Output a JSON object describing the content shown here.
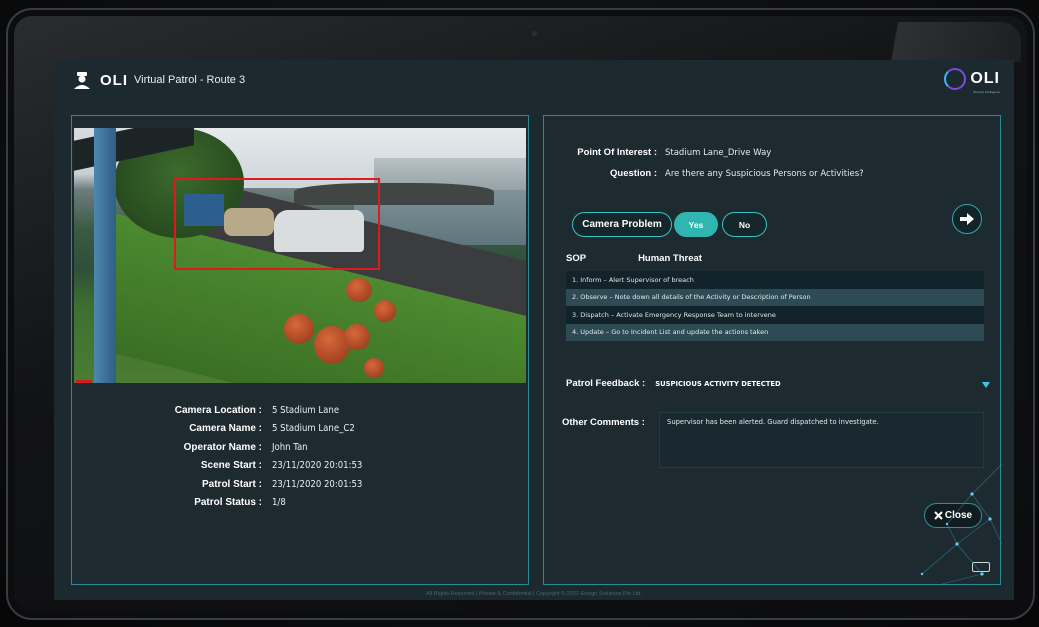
{
  "header": {
    "brand": "OLI",
    "title": "Virtual Patrol - Route 3",
    "logo_text": "OLI",
    "logo_sub": "Security Intelligence"
  },
  "camera": {
    "alert_icon": "warning-triangle-icon",
    "detection_color": "#e0191f"
  },
  "details": [
    {
      "label": "Camera Location :",
      "value": "5 Stadium Lane"
    },
    {
      "label": "Camera Name :",
      "value": "5 Stadium Lane_C2"
    },
    {
      "label": "Operator Name :",
      "value": "John Tan"
    },
    {
      "label": "Scene Start :",
      "value": "23/11/2020 20:01:53"
    },
    {
      "label": "Patrol Start :",
      "value": "23/11/2020 20:01:53"
    },
    {
      "label": "Patrol Status :",
      "value": "1/8"
    }
  ],
  "poi": {
    "label": "Point Of Interest :",
    "value": "Stadium Lane_Drive Way",
    "question_label": "Question :",
    "question": "Are there any Suspicious Persons or Activities?"
  },
  "actions": {
    "camera_problem": "Camera Problem",
    "yes": "Yes",
    "no": "No",
    "next_icon": "arrow-right-icon"
  },
  "sop": {
    "label": "SOP",
    "threat": "Human Threat",
    "steps": [
      "1. Inform – Alert Supervisor of breach",
      "2. Observe – Note down all details of the Activity or Description of Person",
      "3. Dispatch – Activate Emergency Response Team to intervene",
      "4. Update – Go to Incident List and update the actions taken"
    ]
  },
  "feedback": {
    "label": "Patrol Feedback :",
    "value": "SUSPICIOUS ACTIVITY DETECTED"
  },
  "comments": {
    "label": "Other Comments :",
    "value": "Supervisor has been alerted. Guard dispatched to investigate."
  },
  "close_label": "Close",
  "footer": "All Rights Reserved | Private & Confidential | Copyright © 2021 Ensign Solutions Pte Ltd.",
  "colors": {
    "accent": "#2fb6b0",
    "panel_border": "#2a8b94",
    "alert": "#d51b1f"
  }
}
